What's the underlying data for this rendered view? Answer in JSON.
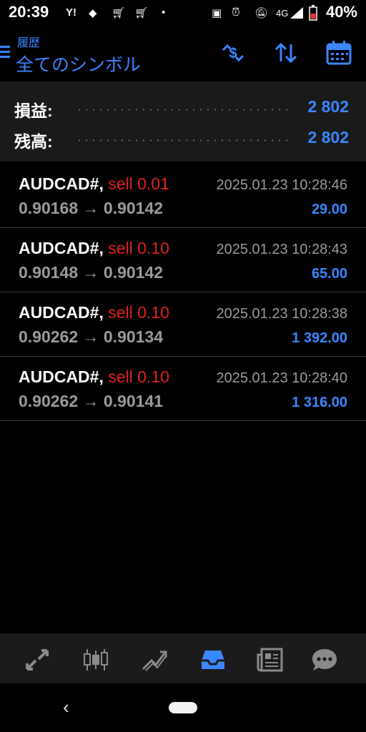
{
  "status_bar": {
    "time": "20:39",
    "battery": "40%",
    "network": "4G",
    "left_icons": [
      "yahoo-icon",
      "box-icon",
      "cart-icon",
      "cart-icon",
      "dot-icon"
    ],
    "right_icons": [
      "cast-icon",
      "alarm-icon",
      "mute-icon",
      "signal-icon",
      "battery-icon"
    ]
  },
  "header": {
    "subtitle": "履歴",
    "title": "全てのシンボル",
    "actions": [
      "currency-swap-icon",
      "sort-icon",
      "calendar-icon"
    ]
  },
  "summary": {
    "profit_label": "損益:",
    "profit_value": "2 802",
    "balance_label": "残高:",
    "balance_value": "2 802"
  },
  "trades": [
    {
      "symbol": "AUDCAD#,",
      "side": "sell 0.01",
      "open": "0.90168",
      "close": "0.90142",
      "arrow": "→",
      "time": "2025.01.23 10:28:46",
      "profit": "29.00"
    },
    {
      "symbol": "AUDCAD#,",
      "side": "sell 0.10",
      "open": "0.90148",
      "close": "0.90142",
      "arrow": "→",
      "time": "2025.01.23 10:28:43",
      "profit": "65.00"
    },
    {
      "symbol": "AUDCAD#,",
      "side": "sell 0.10",
      "open": "0.90262",
      "close": "0.90134",
      "arrow": "→",
      "time": "2025.01.23 10:28:38",
      "profit": "1 392.00"
    },
    {
      "symbol": "AUDCAD#,",
      "side": "sell 0.10",
      "open": "0.90262",
      "close": "0.90141",
      "arrow": "→",
      "time": "2025.01.23 10:28:40",
      "profit": "1 316.00"
    }
  ],
  "bottom_nav": {
    "items": [
      "quotes-icon",
      "chart-icon",
      "trade-icon",
      "history-icon",
      "news-icon",
      "chat-icon"
    ],
    "active": "history-icon"
  },
  "colors": {
    "accent": "#3a86ff",
    "sell": "#e02020",
    "muted": "#9a9a9a",
    "summary_bg": "#1a1a1a",
    "nav_bg": "#1b1b1b"
  }
}
